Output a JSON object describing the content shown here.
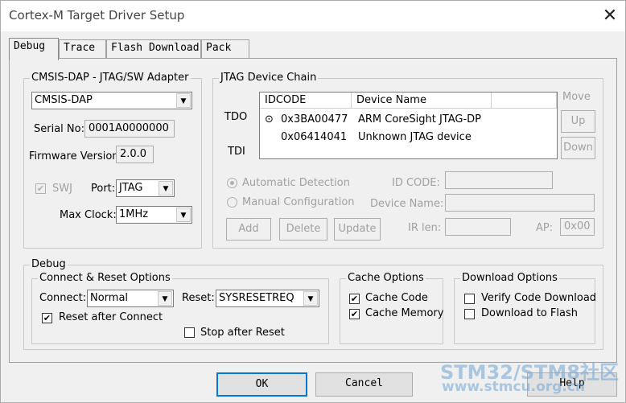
{
  "window": {
    "title": "Cortex-M Target Driver Setup",
    "close": "✕"
  },
  "tabs": [
    "Debug",
    "Trace",
    "Flash Download",
    "Pack"
  ],
  "adapter": {
    "group_label": "CMSIS-DAP - JTAG/SW Adapter",
    "selected": "CMSIS-DAP",
    "serial_label": "Serial No:",
    "serial_value": "0001A0000000",
    "firmware_label": "Firmware Version:",
    "firmware_value": "2.0.0",
    "swj_label": "SWJ",
    "port_label": "Port:",
    "port_value": "JTAG",
    "maxclock_label": "Max Clock:",
    "maxclock_value": "1MHz"
  },
  "jtag": {
    "group_label": "JTAG Device Chain",
    "tdo": "TDO",
    "tdi": "TDI",
    "columns": [
      "IDCODE",
      "Device Name"
    ],
    "rows": [
      {
        "idcode": "0x3BA00477",
        "name": "ARM CoreSight JTAG-DP"
      },
      {
        "idcode": "0x06414041",
        "name": "Unknown JTAG device"
      }
    ],
    "move_label": "Move",
    "up": "Up",
    "down": "Down",
    "auto_detect": "Automatic Detection",
    "manual_config": "Manual Configuration",
    "idcode_label": "ID CODE:",
    "devname_label": "Device Name:",
    "irlen_label": "IR len:",
    "ap_label": "AP:",
    "ap_value": "0x00",
    "add": "Add",
    "delete": "Delete",
    "update": "Update"
  },
  "debug": {
    "group_label": "Debug",
    "connect_reset": {
      "label": "Connect & Reset Options",
      "connect_label": "Connect:",
      "connect_value": "Normal",
      "reset_label": "Reset:",
      "reset_value": "SYSRESETREQ",
      "reset_after_connect": "Reset after Connect",
      "stop_after_reset": "Stop after Reset"
    },
    "cache": {
      "label": "Cache Options",
      "cache_code": "Cache Code",
      "cache_memory": "Cache Memory"
    },
    "download": {
      "label": "Download Options",
      "verify": "Verify Code Download",
      "to_flash": "Download to Flash"
    }
  },
  "buttons": {
    "ok": "OK",
    "cancel": "Cancel",
    "help": "Help"
  },
  "watermark": {
    "line1": "STM32/STM8社区",
    "line2": "www.stmcu.org.cn"
  }
}
